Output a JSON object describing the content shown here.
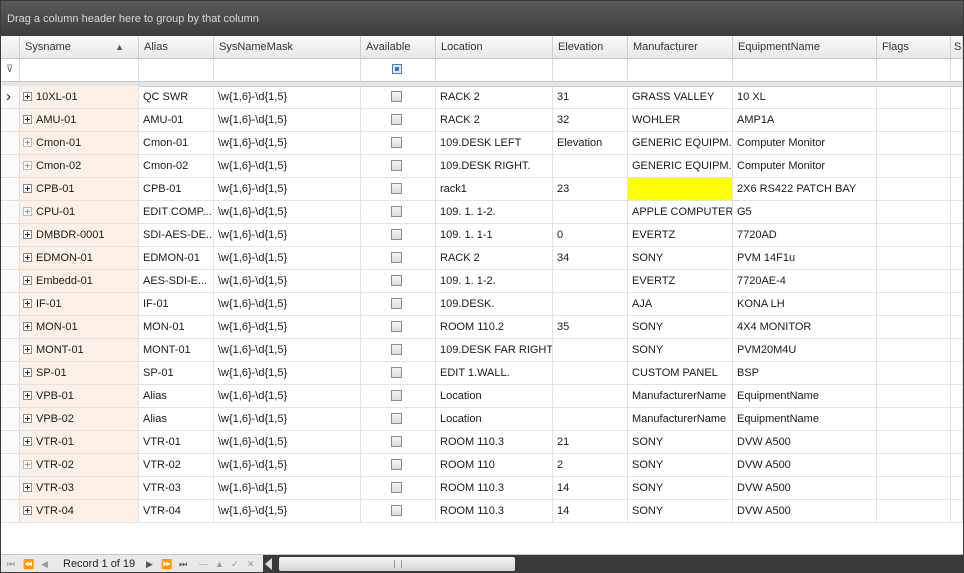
{
  "group_panel": {
    "text": "Drag a column header here to group by that column"
  },
  "columns": [
    {
      "label": "Sysname"
    },
    {
      "label": "Alias"
    },
    {
      "label": "SysNameMask"
    },
    {
      "label": "Available"
    },
    {
      "label": "Location"
    },
    {
      "label": "Elevation"
    },
    {
      "label": "Manufacturer"
    },
    {
      "label": "EquipmentName"
    },
    {
      "label": "Flags"
    },
    {
      "label": "S"
    }
  ],
  "sort": {
    "column": "Sysname",
    "direction": "ascending",
    "icon": "sort-ascending-icon"
  },
  "rows": [
    {
      "sysname": "10XL-01",
      "alias": "QC SWR",
      "mask": "\\w{1,6}-\\d{1,5}",
      "location": "RACK 2",
      "elevation": "31",
      "manufacturer": "GRASS VALLEY",
      "equipment": "10 XL",
      "flags": ""
    },
    {
      "sysname": "AMU-01",
      "alias": "AMU-01",
      "mask": "\\w{1,6}-\\d{1,5}",
      "location": "RACK 2",
      "elevation": "32",
      "manufacturer": "WOHLER",
      "equipment": "AMP1A",
      "flags": ""
    },
    {
      "sysname": "Cmon-01",
      "alias": "Cmon-01",
      "mask": "\\w{1,6}-\\d{1,5}",
      "location": "109.DESK LEFT",
      "elevation": "Elevation",
      "manufacturer": "GENERIC EQUIPM...",
      "equipment": "Computer Monitor",
      "flags": ""
    },
    {
      "sysname": "Cmon-02",
      "alias": "Cmon-02",
      "mask": "\\w{1,6}-\\d{1,5}",
      "location": "109.DESK RIGHT.",
      "elevation": "",
      "manufacturer": "GENERIC EQUIPM...",
      "equipment": "Computer Monitor",
      "flags": ""
    },
    {
      "sysname": "CPB-01",
      "alias": "CPB-01",
      "mask": "\\w{1,6}-\\d{1,5}",
      "location": "rack1",
      "elevation": "23",
      "manufacturer": "",
      "equipment": "2X6 RS422 PATCH BAY",
      "flags": ""
    },
    {
      "sysname": "CPU-01",
      "alias": "EDIT COMP...",
      "mask": "\\w{1,6}-\\d{1,5}",
      "location": "109. 1. 1-2.",
      "elevation": "",
      "manufacturer": "APPLE COMPUTERS",
      "equipment": "G5",
      "flags": ""
    },
    {
      "sysname": "DMBDR-0001",
      "alias": "SDI-AES-DE...",
      "mask": "\\w{1,6}-\\d{1,5}",
      "location": "109. 1. 1-1",
      "elevation": "0",
      "manufacturer": "EVERTZ",
      "equipment": "7720AD",
      "flags": ""
    },
    {
      "sysname": "EDMON-01",
      "alias": "EDMON-01",
      "mask": "\\w{1,6}-\\d{1,5}",
      "location": "RACK 2",
      "elevation": "34",
      "manufacturer": "SONY",
      "equipment": "PVM 14F1u",
      "flags": ""
    },
    {
      "sysname": "Embedd-01",
      "alias": "AES-SDI-E...",
      "mask": "\\w{1,6}-\\d{1,5}",
      "location": "109. 1. 1-2.",
      "elevation": "",
      "manufacturer": "EVERTZ",
      "equipment": "7720AE-4",
      "flags": ""
    },
    {
      "sysname": "IF-01",
      "alias": "IF-01",
      "mask": "\\w{1,6}-\\d{1,5}",
      "location": "109.DESK.",
      "elevation": "",
      "manufacturer": "AJA",
      "equipment": "KONA LH",
      "flags": ""
    },
    {
      "sysname": "MON-01",
      "alias": "MON-01",
      "mask": "\\w{1,6}-\\d{1,5}",
      "location": "ROOM 110.2",
      "elevation": "35",
      "manufacturer": "SONY",
      "equipment": "4X4 MONITOR",
      "flags": ""
    },
    {
      "sysname": "MONT-01",
      "alias": "MONT-01",
      "mask": "\\w{1,6}-\\d{1,5}",
      "location": "109.DESK FAR RIGHT.",
      "elevation": "",
      "manufacturer": "SONY",
      "equipment": "PVM20M4U",
      "flags": ""
    },
    {
      "sysname": "SP-01",
      "alias": "SP-01",
      "mask": "\\w{1,6}-\\d{1,5}",
      "location": "EDIT 1.WALL.",
      "elevation": "",
      "manufacturer": "CUSTOM PANEL",
      "equipment": "BSP",
      "flags": ""
    },
    {
      "sysname": "VPB-01",
      "alias": "Alias",
      "mask": "\\w{1,6}-\\d{1,5}",
      "location": "Location",
      "elevation": "",
      "manufacturer": "ManufacturerName",
      "equipment": "EquipmentName",
      "flags": ""
    },
    {
      "sysname": "VPB-02",
      "alias": "Alias",
      "mask": "\\w{1,6}-\\d{1,5}",
      "location": "Location",
      "elevation": "",
      "manufacturer": "ManufacturerName",
      "equipment": "EquipmentName",
      "flags": ""
    },
    {
      "sysname": "VTR-01",
      "alias": "VTR-01",
      "mask": "\\w{1,6}-\\d{1,5}",
      "location": "ROOM 110.3",
      "elevation": "21",
      "manufacturer": "SONY",
      "equipment": "DVW A500",
      "flags": ""
    },
    {
      "sysname": "VTR-02",
      "alias": "VTR-02",
      "mask": "\\w{1,6}-\\d{1,5}",
      "location": "ROOM 110",
      "elevation": "2",
      "manufacturer": "SONY",
      "equipment": "DVW A500",
      "flags": ""
    },
    {
      "sysname": "VTR-03",
      "alias": "VTR-03",
      "mask": "\\w{1,6}-\\d{1,5}",
      "location": "ROOM 110.3",
      "elevation": "14",
      "manufacturer": "SONY",
      "equipment": "DVW A500",
      "flags": ""
    },
    {
      "sysname": "VTR-04",
      "alias": "VTR-04",
      "mask": "\\w{1,6}-\\d{1,5}",
      "location": "ROOM 110.3",
      "elevation": "14",
      "manufacturer": "SONY",
      "equipment": "DVW A500",
      "flags": ""
    }
  ],
  "highlight": {
    "row_index": 4,
    "column": "manufacturer",
    "color": "#ffff00"
  },
  "current_row_index": 0,
  "navigator": {
    "record_text": "Record 1 of 19",
    "buttons": [
      "first-icon",
      "prev-page-icon",
      "prev-icon",
      "next-icon",
      "next-page-icon",
      "last-icon",
      "append-icon",
      "delete-icon",
      "edit-icon",
      "end-edit-icon",
      "cancel-edit-icon"
    ]
  },
  "colors": {
    "group_panel_bg": "#3c3c3c",
    "sysname_bg": "#fdf0e6",
    "highlight": "#ffff00",
    "scrollbar_bg": "#3a3a3a"
  }
}
